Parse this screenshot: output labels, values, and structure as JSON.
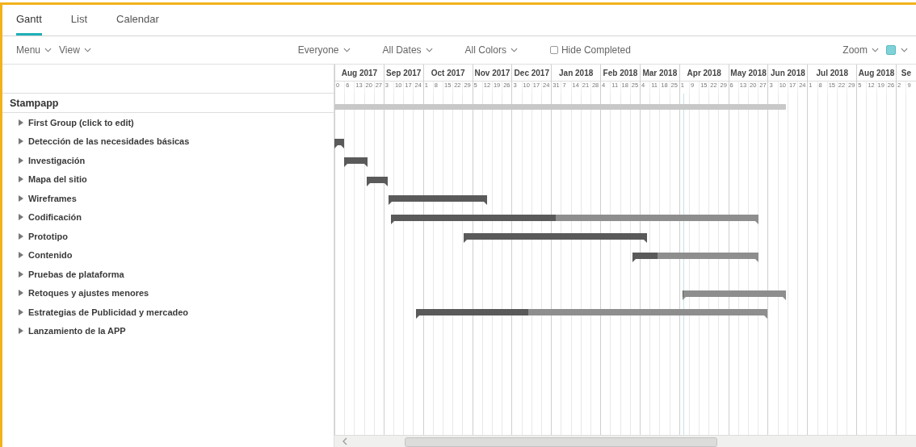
{
  "tabs": [
    {
      "label": "Gantt",
      "selected": true
    },
    {
      "label": "List",
      "selected": false
    },
    {
      "label": "Calendar",
      "selected": false
    }
  ],
  "toolbar": {
    "menus": [
      "Menu",
      "View"
    ],
    "filters": [
      "Everyone",
      "All Dates",
      "All Colors"
    ],
    "hide_completed": {
      "label": "Hide Completed",
      "checked": false
    },
    "zoom": "Zoom"
  },
  "timeline": {
    "months": [
      {
        "label": "Aug 2017",
        "days": [
          "0",
          "6",
          "13",
          "20",
          "27"
        ]
      },
      {
        "label": "Sep 2017",
        "days": [
          "3",
          "10",
          "17",
          "24"
        ]
      },
      {
        "label": "Oct 2017",
        "days": [
          "1",
          "8",
          "15",
          "22",
          "29"
        ]
      },
      {
        "label": "Nov 2017",
        "days": [
          "5",
          "12",
          "19",
          "26"
        ]
      },
      {
        "label": "Dec 2017",
        "days": [
          "3",
          "10",
          "17",
          "24"
        ]
      },
      {
        "label": "Jan 2018",
        "days": [
          "31",
          "7",
          "14",
          "21",
          "28"
        ]
      },
      {
        "label": "Feb 2018",
        "days": [
          "4",
          "11",
          "18",
          "25"
        ]
      },
      {
        "label": "Mar 2018",
        "days": [
          "4",
          "11",
          "18",
          "25"
        ]
      },
      {
        "label": "Apr 2018",
        "days": [
          "1",
          "9",
          "15",
          "22",
          "29"
        ]
      },
      {
        "label": "May 2018",
        "days": [
          "6",
          "13",
          "20",
          "27"
        ]
      },
      {
        "label": "Jun 2018",
        "days": [
          "3",
          "10",
          "17",
          "24"
        ]
      },
      {
        "label": "Jul 2018",
        "days": [
          "1",
          "8",
          "15",
          "22",
          "29"
        ]
      },
      {
        "label": "Aug 2018",
        "days": [
          "5",
          "12",
          "19",
          "26"
        ]
      },
      {
        "label": "Se",
        "days": [
          "2",
          "9"
        ]
      }
    ]
  },
  "project": {
    "name": "Stampapp"
  },
  "tasks": [
    {
      "name": "First Group (click to edit)",
      "expanded": false
    },
    {
      "name": "Detección de las necesidades básicas",
      "expanded": false,
      "bar": {
        "level": 1
      }
    },
    {
      "name": "Investigación",
      "expanded": false,
      "bar": {
        "level": 1
      }
    },
    {
      "name": "Mapa del sitio",
      "expanded": false,
      "bar": {
        "level": 1
      }
    },
    {
      "name": "Wireframes",
      "expanded": false,
      "bar": {
        "level": 1
      }
    },
    {
      "name": "Codificación",
      "expanded": false,
      "bar": {
        "level": 0.45
      }
    },
    {
      "name": "Prototipo",
      "expanded": false,
      "bar": {
        "level": 1
      }
    },
    {
      "name": "Contenido",
      "expanded": false,
      "bar": {
        "level": 0.2
      }
    },
    {
      "name": "Pruebas de plataforma",
      "expanded": false
    },
    {
      "name": "Retoques y ajustes menores",
      "expanded": false,
      "bar": {
        "level": 0
      }
    },
    {
      "name": "Estrategias de Publicidad y mercadeo",
      "expanded": false,
      "bar": {
        "level": 0.32
      }
    },
    {
      "name": "Lanzamiento de la APP",
      "expanded": false
    }
  ]
}
